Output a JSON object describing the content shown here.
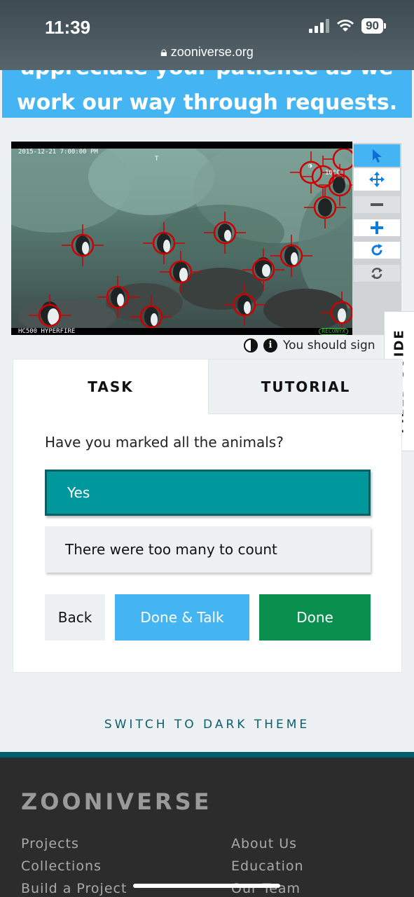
{
  "status_bar": {
    "time": "11:39",
    "battery": "90",
    "url": "zooniverse.org",
    "icons": [
      "signal-icon",
      "wifi-icon",
      "battery-icon",
      "lock-icon"
    ]
  },
  "banner": {
    "line1": "appreciate your patience as we",
    "line2": "work our way through requests."
  },
  "subject": {
    "timestamp": "2015-12-21 7:00:00 PM",
    "mode": "T",
    "temperature": "10°C",
    "camera": "HC500 HYPERFIRE",
    "brand": "RECONYX"
  },
  "toolbar": {
    "tools": [
      "pointer-icon",
      "move-icon",
      "zoom-out-icon",
      "zoom-in-icon",
      "rotate-icon",
      "reset-icon"
    ],
    "active": "pointer-icon"
  },
  "notice": {
    "text": "You should sign"
  },
  "field_guide": {
    "label": "FIELD GUIDE"
  },
  "task": {
    "tabs": [
      "TASK",
      "TUTORIAL"
    ],
    "active_tab": "TASK",
    "question": "Have you marked all the animals?",
    "answers": [
      "Yes",
      "There were too many to count"
    ],
    "selected_answer": "Yes",
    "buttons": {
      "back": "Back",
      "done_talk": "Done & Talk",
      "done": "Done"
    }
  },
  "theme_toggle": "SWITCH TO DARK THEME",
  "footer": {
    "logo": "ZOONIVERSE",
    "links_left": [
      "Projects",
      "Collections",
      "Build a Project"
    ],
    "links_right": [
      "About Us",
      "Education",
      "Our Team"
    ]
  },
  "colors": {
    "banner": "#44b5f2",
    "teal": "#00979d",
    "done_green": "#0a8f4e",
    "marker_red": "#cc0000",
    "footer_bg": "#2c2c2c"
  }
}
